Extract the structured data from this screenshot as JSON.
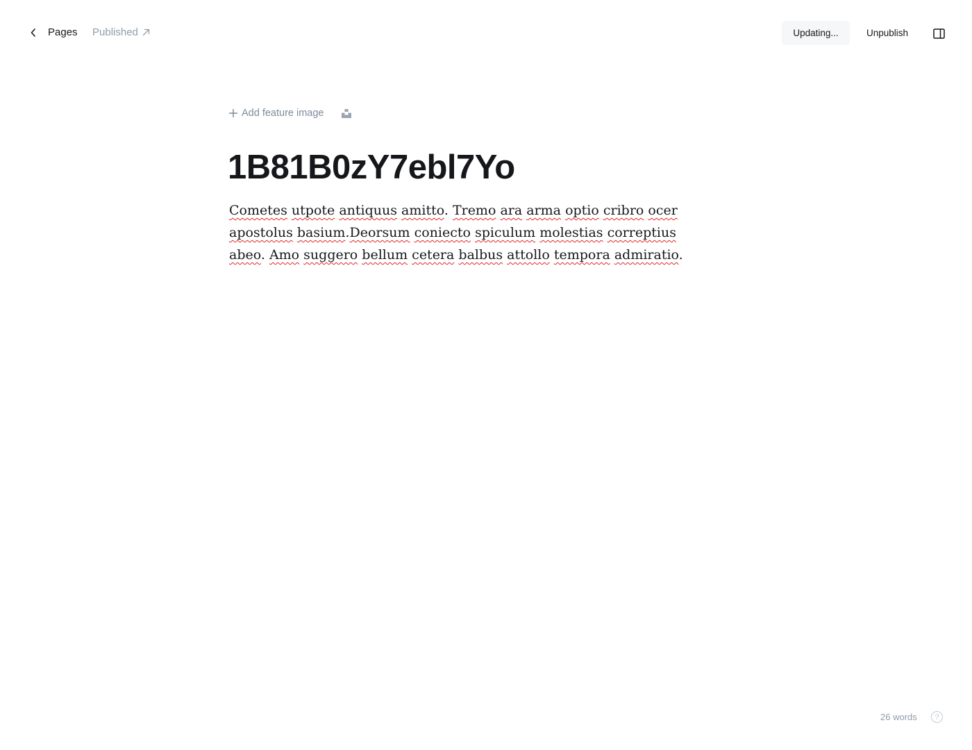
{
  "header": {
    "back_label": "Pages",
    "status_label": "Published",
    "updating_label": "Updating...",
    "unpublish_label": "Unpublish"
  },
  "editor": {
    "add_feature_image_label": "Add feature image",
    "title": "1B81B0zY7ebl7Yo",
    "body": "Cometes utpote antiquus amitto. Tremo ara arma optio cribro ocer apostolus basium.Deorsum coniecto spiculum molestias correptius abeo. Amo suggero bellum cetera balbus attollo tempora admiratio."
  },
  "footer": {
    "word_count": "26 words",
    "help_glyph": "?"
  },
  "colors": {
    "text": "#15171a",
    "muted": "#8e9cac",
    "spellcheck": "#e02424",
    "button_bg": "#f6f7f8"
  }
}
